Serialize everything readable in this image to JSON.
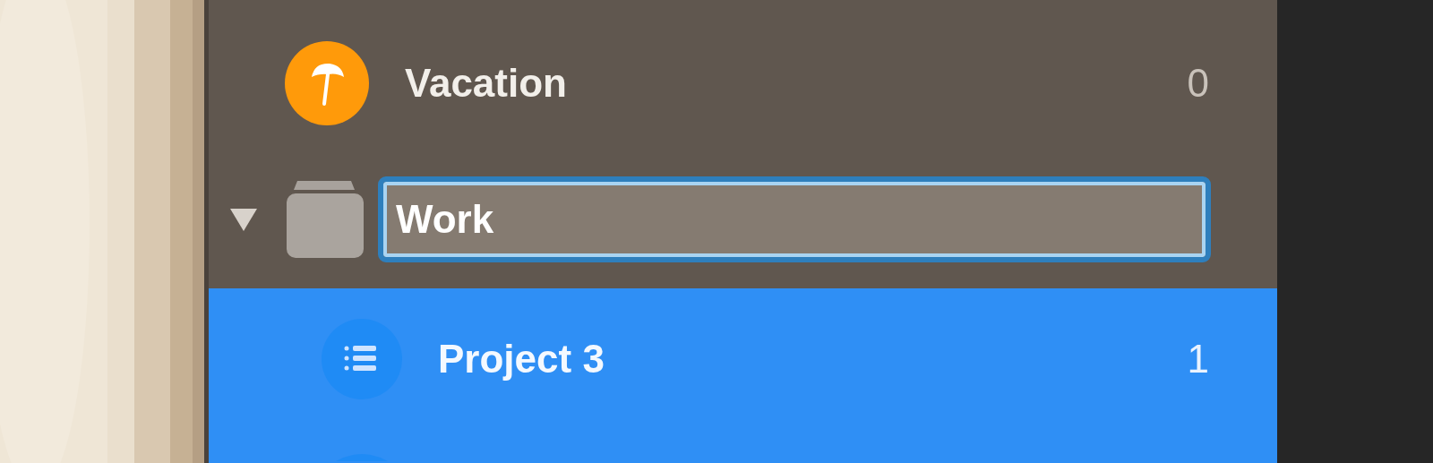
{
  "sidebar": {
    "items": [
      {
        "kind": "list",
        "name": "Vacation",
        "count": "0",
        "color": "#ff9a0a",
        "selected": false
      },
      {
        "kind": "group",
        "name": "Work",
        "editing": true,
        "expanded": true,
        "selected": false,
        "children": [
          {
            "kind": "list",
            "name": "Project 3",
            "count": "1",
            "color": "#1f8bf5",
            "selected": true
          }
        ]
      }
    ]
  }
}
